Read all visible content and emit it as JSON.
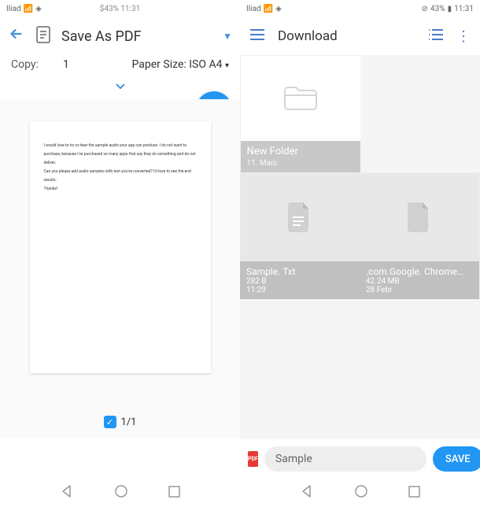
{
  "left": {
    "status": {
      "carrier": "Iliad",
      "battery": "43%",
      "time": "11:31",
      "center": "$43% 11:31"
    },
    "appbar": {
      "title": "Save As PDF"
    },
    "options": {
      "copies_label": "Copy:",
      "copies_value": "1",
      "paper_label": "Paper Size:",
      "paper_value": "ISO A4"
    },
    "preview": {
      "lines": [
        "I would love to try or hear the sample audio your app can produce. I do not want to",
        "purchase, because I've purchased so many apps that say they do something and do not",
        "deliver.",
        "Can you please add audio samples with text you've converted? I'd love to see the end",
        "results.",
        "Thanks!"
      ],
      "page_indicator": "1/1"
    }
  },
  "right": {
    "status": {
      "carrier": "Iliad",
      "battery": "43%",
      "time": "11:31"
    },
    "appbar": {
      "title": "Download"
    },
    "items": [
      {
        "name": "New Folder",
        "date": "11. Marc",
        "type": "folder"
      },
      {
        "name": "Sample. Txt",
        "size": "282 B",
        "date": "11:29",
        "type": "file"
      },
      {
        "name": ".com.Google. Chrome…",
        "size": "42.24 MB",
        "date": "28 Febr",
        "type": "file"
      }
    ],
    "bottom": {
      "filename": "Sample",
      "save_label": "SAVE",
      "badge": "PDF"
    }
  }
}
